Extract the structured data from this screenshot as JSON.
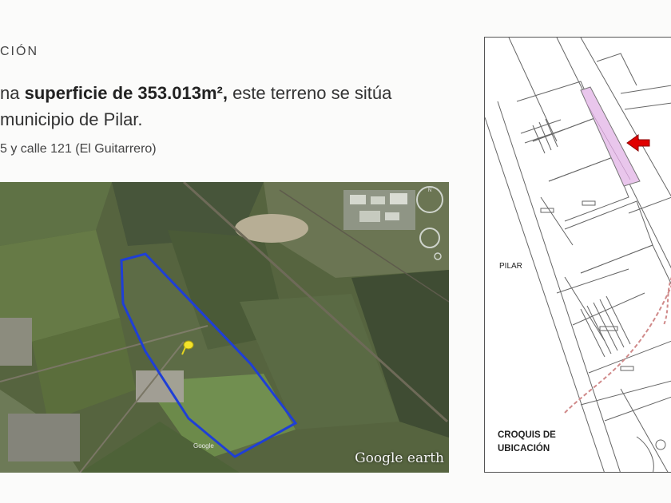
{
  "section_heading": "CIÓN",
  "description": {
    "line1_prefix": "na ",
    "line1_bold": "superficie de 353.013m², ",
    "line1_suffix": "este terreno se sitúa",
    "line2": "municipio de Pilar."
  },
  "address": "5 y calle 121 (El Guitarrero)",
  "aerial_map": {
    "watermark": "Google earth",
    "credit": "Google",
    "compass_letter": "N",
    "plot_outline_color": "#1f3fd6",
    "pin_color": "#f3e22a"
  },
  "sketch_map": {
    "locality": "PILAR",
    "caption_line1": "CROQUIS DE",
    "caption_line2": "UBICACIÓN",
    "parcel_color": "#e9c6ec",
    "arrow_color": "#e00000"
  }
}
